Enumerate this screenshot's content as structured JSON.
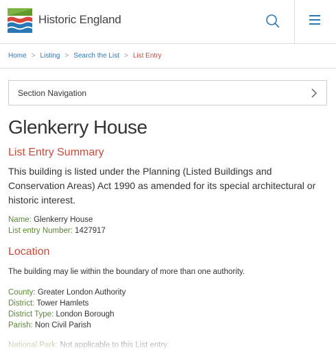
{
  "header": {
    "brand": "Historic England",
    "colors": {
      "green": "#7cb342",
      "red": "#d9453a",
      "blue": "#2a77b8"
    }
  },
  "breadcrumb": [
    {
      "label": "Home"
    },
    {
      "label": "Listing"
    },
    {
      "label": "Search the List"
    },
    {
      "label": "List Entry"
    }
  ],
  "section_nav": {
    "label": "Section Navigation"
  },
  "page": {
    "title": "Glenkerry House",
    "summary_heading": "List Entry Summary",
    "summary_text": "This building is listed under the Planning (Listed Buildings and Conservation Areas) Act 1990 as amended for its special architectural or historic interest.",
    "name_key": "Name:",
    "name_value": "Glenkerry House",
    "number_key": "List entry Number:",
    "number_value": "1427917"
  },
  "location": {
    "heading": "Location",
    "intro": "The building may lie within the boundary of more than one authority.",
    "fields": [
      {
        "key": "County:",
        "value": "Greater London Authority"
      },
      {
        "key": "District:",
        "value": "Tower Hamlets"
      },
      {
        "key": "District Type:",
        "value": "London Borough"
      },
      {
        "key": "Parish:",
        "value": "Non Civil Parish"
      }
    ],
    "national_park_key": "National Park:",
    "national_park_value": "Not applicable to this List entry."
  }
}
